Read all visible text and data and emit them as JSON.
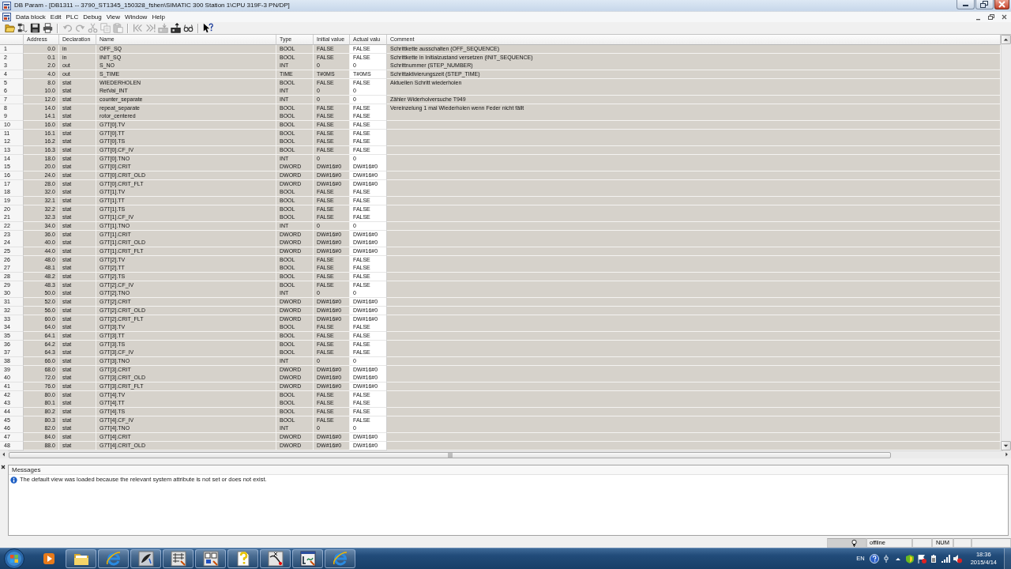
{
  "window": {
    "title": "DB Param - [DB1311 -- 3790_ST1345_150328_fshen\\SIMATIC 300 Station 1\\CPU 319F-3 PN/DP]"
  },
  "menu": [
    "Data block",
    "Edit",
    "PLC",
    "Debug",
    "View",
    "Window",
    "Help"
  ],
  "toolbar": [
    [
      {
        "kind": "open",
        "disabled": false
      },
      {
        "kind": "nodes",
        "disabled": false
      },
      {
        "kind": "save",
        "disabled": false
      },
      {
        "kind": "print",
        "disabled": false
      }
    ],
    [
      {
        "kind": "undo",
        "disabled": true
      },
      {
        "kind": "redo",
        "disabled": true
      },
      {
        "kind": "cut",
        "disabled": true
      },
      {
        "kind": "copy",
        "disabled": true
      },
      {
        "kind": "paste",
        "disabled": true
      }
    ],
    [
      {
        "kind": "first",
        "disabled": true
      },
      {
        "kind": "last",
        "disabled": true
      },
      {
        "kind": "download",
        "disabled": true
      },
      {
        "kind": "upload",
        "disabled": false
      },
      {
        "kind": "monitor",
        "disabled": false
      }
    ],
    [
      {
        "kind": "help",
        "disabled": false
      }
    ]
  ],
  "table": {
    "columns": [
      "Address",
      "Declaration",
      "Name",
      "Type",
      "Initial value",
      "Actual valu",
      "Comment"
    ],
    "rows": [
      {
        "number": "1",
        "cells": [
          "0.0",
          "in",
          "OFF_SQ",
          "BOOL",
          "FALSE",
          "FALSE",
          "Schrittkette ausschalten (OFF_SEQUENCE)"
        ]
      },
      {
        "number": "2",
        "cells": [
          "0.1",
          "in",
          "INIT_SQ",
          "BOOL",
          "FALSE",
          "FALSE",
          "Schrittkette in Initialzustand versetzen (INIT_SEQUENCE)"
        ]
      },
      {
        "number": "3",
        "cells": [
          "2.0",
          "out",
          "S_NO",
          "INT",
          "0",
          "0",
          "Schrittnummer (STEP_NUMBER)"
        ]
      },
      {
        "number": "4",
        "cells": [
          "4.0",
          "out",
          "S_TIME",
          "TIME",
          "T#0MS",
          "T#0MS",
          "Schrittaktivierungszeit (STEP_TIME)"
        ]
      },
      {
        "number": "5",
        "cells": [
          "8.0",
          "stat",
          "WIEDERHOLEN",
          "BOOL",
          "FALSE",
          "FALSE",
          "Aktuellen Schritt wiederholen"
        ]
      },
      {
        "number": "6",
        "cells": [
          "10.0",
          "stat",
          "RetVal_INT",
          "INT",
          "0",
          "0"
        ]
      },
      {
        "number": "7",
        "cells": [
          "12.0",
          "stat",
          "counter_separate",
          "INT",
          "0",
          "0",
          "Zähler Widerholversuche T949"
        ]
      },
      {
        "number": "8",
        "cells": [
          "14.0",
          "stat",
          "repeat_separate",
          "BOOL",
          "FALSE",
          "FALSE",
          "Vereinzelung 1 mal Wiederholen wenn Feder nicht fällt"
        ]
      },
      {
        "number": "9",
        "cells": [
          "14.1",
          "stat",
          "rotor_centered",
          "BOOL",
          "FALSE",
          "FALSE"
        ]
      },
      {
        "number": "10",
        "cells": [
          "16.0",
          "stat",
          "G7T[0].TV",
          "BOOL",
          "FALSE",
          "FALSE"
        ]
      },
      {
        "number": "11",
        "cells": [
          "16.1",
          "stat",
          "G7T[0].TT",
          "BOOL",
          "FALSE",
          "FALSE"
        ]
      },
      {
        "number": "12",
        "cells": [
          "16.2",
          "stat",
          "G7T[0].TS",
          "BOOL",
          "FALSE",
          "FALSE"
        ]
      },
      {
        "number": "13",
        "cells": [
          "16.3",
          "stat",
          "G7T[0].CF_IV",
          "BOOL",
          "FALSE",
          "FALSE"
        ]
      },
      {
        "number": "14",
        "cells": [
          "18.0",
          "stat",
          "G7T[0].TNO",
          "INT",
          "0",
          "0"
        ]
      },
      {
        "number": "15",
        "cells": [
          "20.0",
          "stat",
          "G7T[0].CRIT",
          "DWORD",
          "DW#16#0",
          "DW#16#0"
        ]
      },
      {
        "number": "16",
        "cells": [
          "24.0",
          "stat",
          "G7T[0].CRIT_OLD",
          "DWORD",
          "DW#16#0",
          "DW#16#0"
        ]
      },
      {
        "number": "17",
        "cells": [
          "28.0",
          "stat",
          "G7T[0].CRIT_FLT",
          "DWORD",
          "DW#16#0",
          "DW#16#0"
        ]
      },
      {
        "number": "18",
        "cells": [
          "32.0",
          "stat",
          "G7T[1].TV",
          "BOOL",
          "FALSE",
          "FALSE"
        ]
      },
      {
        "number": "19",
        "cells": [
          "32.1",
          "stat",
          "G7T[1].TT",
          "BOOL",
          "FALSE",
          "FALSE"
        ]
      },
      {
        "number": "20",
        "cells": [
          "32.2",
          "stat",
          "G7T[1].TS",
          "BOOL",
          "FALSE",
          "FALSE"
        ]
      },
      {
        "number": "21",
        "cells": [
          "32.3",
          "stat",
          "G7T[1].CF_IV",
          "BOOL",
          "FALSE",
          "FALSE"
        ]
      },
      {
        "number": "22",
        "cells": [
          "34.0",
          "stat",
          "G7T[1].TNO",
          "INT",
          "0",
          "0"
        ]
      },
      {
        "number": "23",
        "cells": [
          "36.0",
          "stat",
          "G7T[1].CRIT",
          "DWORD",
          "DW#16#0",
          "DW#16#0"
        ]
      },
      {
        "number": "24",
        "cells": [
          "40.0",
          "stat",
          "G7T[1].CRIT_OLD",
          "DWORD",
          "DW#16#0",
          "DW#16#0"
        ]
      },
      {
        "number": "25",
        "cells": [
          "44.0",
          "stat",
          "G7T[1].CRIT_FLT",
          "DWORD",
          "DW#16#0",
          "DW#16#0"
        ]
      },
      {
        "number": "26",
        "cells": [
          "48.0",
          "stat",
          "G7T[2].TV",
          "BOOL",
          "FALSE",
          "FALSE"
        ]
      },
      {
        "number": "27",
        "cells": [
          "48.1",
          "stat",
          "G7T[2].TT",
          "BOOL",
          "FALSE",
          "FALSE"
        ]
      },
      {
        "number": "28",
        "cells": [
          "48.2",
          "stat",
          "G7T[2].TS",
          "BOOL",
          "FALSE",
          "FALSE"
        ]
      },
      {
        "number": "29",
        "cells": [
          "48.3",
          "stat",
          "G7T[2].CF_IV",
          "BOOL",
          "FALSE",
          "FALSE"
        ]
      },
      {
        "number": "30",
        "cells": [
          "50.0",
          "stat",
          "G7T[2].TNO",
          "INT",
          "0",
          "0"
        ]
      },
      {
        "number": "31",
        "cells": [
          "52.0",
          "stat",
          "G7T[2].CRIT",
          "DWORD",
          "DW#16#0",
          "DW#16#0"
        ]
      },
      {
        "number": "32",
        "cells": [
          "56.0",
          "stat",
          "G7T[2].CRIT_OLD",
          "DWORD",
          "DW#16#0",
          "DW#16#0"
        ]
      },
      {
        "number": "33",
        "cells": [
          "60.0",
          "stat",
          "G7T[2].CRIT_FLT",
          "DWORD",
          "DW#16#0",
          "DW#16#0"
        ]
      },
      {
        "number": "34",
        "cells": [
          "64.0",
          "stat",
          "G7T[3].TV",
          "BOOL",
          "FALSE",
          "FALSE"
        ]
      },
      {
        "number": "35",
        "cells": [
          "64.1",
          "stat",
          "G7T[3].TT",
          "BOOL",
          "FALSE",
          "FALSE"
        ]
      },
      {
        "number": "36",
        "cells": [
          "64.2",
          "stat",
          "G7T[3].TS",
          "BOOL",
          "FALSE",
          "FALSE"
        ]
      },
      {
        "number": "37",
        "cells": [
          "64.3",
          "stat",
          "G7T[3].CF_IV",
          "BOOL",
          "FALSE",
          "FALSE"
        ]
      },
      {
        "number": "38",
        "cells": [
          "66.0",
          "stat",
          "G7T[3].TNO",
          "INT",
          "0",
          "0"
        ]
      },
      {
        "number": "39",
        "cells": [
          "68.0",
          "stat",
          "G7T[3].CRIT",
          "DWORD",
          "DW#16#0",
          "DW#16#0"
        ]
      },
      {
        "number": "40",
        "cells": [
          "72.0",
          "stat",
          "G7T[3].CRIT_OLD",
          "DWORD",
          "DW#16#0",
          "DW#16#0"
        ]
      },
      {
        "number": "41",
        "cells": [
          "76.0",
          "stat",
          "G7T[3].CRIT_FLT",
          "DWORD",
          "DW#16#0",
          "DW#16#0"
        ]
      },
      {
        "number": "42",
        "cells": [
          "80.0",
          "stat",
          "G7T[4].TV",
          "BOOL",
          "FALSE",
          "FALSE"
        ]
      },
      {
        "number": "43",
        "cells": [
          "80.1",
          "stat",
          "G7T[4].TT",
          "BOOL",
          "FALSE",
          "FALSE"
        ]
      },
      {
        "number": "44",
        "cells": [
          "80.2",
          "stat",
          "G7T[4].TS",
          "BOOL",
          "FALSE",
          "FALSE"
        ]
      },
      {
        "number": "45",
        "cells": [
          "80.3",
          "stat",
          "G7T[4].CF_IV",
          "BOOL",
          "FALSE",
          "FALSE"
        ]
      },
      {
        "number": "46",
        "cells": [
          "82.0",
          "stat",
          "G7T[4].TNO",
          "INT",
          "0",
          "0"
        ]
      },
      {
        "number": "47",
        "cells": [
          "84.0",
          "stat",
          "G7T[4].CRIT",
          "DWORD",
          "DW#16#0",
          "DW#16#0"
        ]
      },
      {
        "number": "48",
        "cells": [
          "88.0",
          "stat",
          "G7T[4].CRIT_OLD",
          "DWORD",
          "DW#16#0",
          "DW#16#0"
        ]
      }
    ]
  },
  "messages": {
    "title": "Messages",
    "items": [
      {
        "kind": "info",
        "text": "The default view was loaded because the relevant system attribute is not set or does not exist."
      }
    ]
  },
  "status_bar": {
    "connection": "offline",
    "keyboard": "NUM"
  },
  "taskbar": {
    "apps": [
      {
        "kind": "media",
        "running": false
      },
      {
        "kind": "folder",
        "running": true
      },
      {
        "kind": "browser",
        "running": true
      },
      {
        "kind": "quill",
        "running": true
      },
      {
        "kind": "ladder",
        "running": true
      },
      {
        "kind": "blocks",
        "running": true
      },
      {
        "kind": "helpdoc",
        "running": true
      },
      {
        "kind": "curve",
        "running": true
      },
      {
        "kind": "chartwin",
        "running": true
      },
      {
        "kind": "browser",
        "running": true
      }
    ],
    "language": "EN",
    "time": "18:36",
    "date": "2015/4/14"
  }
}
